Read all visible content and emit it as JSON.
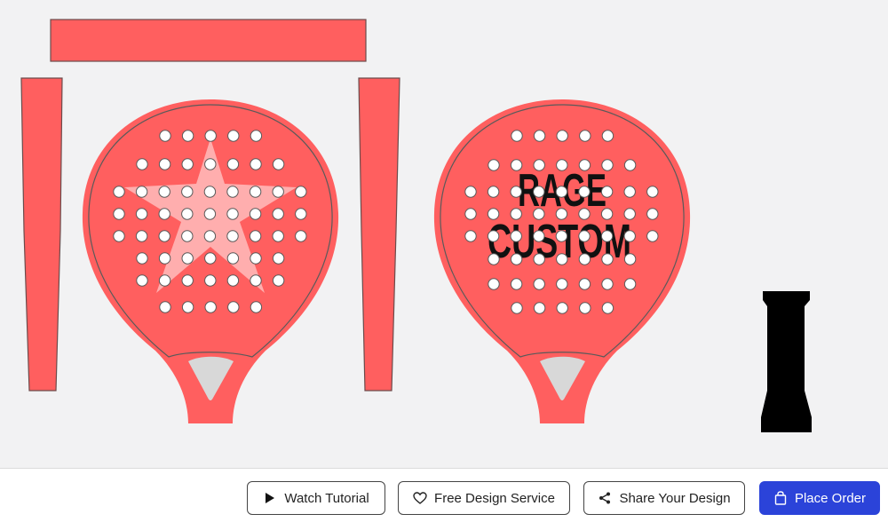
{
  "design": {
    "paddle_color": "#ff5f5f",
    "outline_color": "#5a5a5a",
    "hole_color": "#ffffff",
    "throat_color": "#d8d8d8",
    "star_color": "#ffc8c8",
    "text_color": "#111111",
    "grip_color": "#000000",
    "front_text_line1": "RAGE",
    "front_text_line2": "CUSTOM"
  },
  "footer": {
    "tutorial_label": "Watch Tutorial",
    "tutorial_icon": "play-icon",
    "free_design_label": "Free Design Service",
    "free_design_icon": "heart-icon",
    "share_label": "Share Your Design",
    "share_icon": "share-icon",
    "order_label": "Place Order",
    "order_icon": "bag-icon",
    "primary_color": "#2b43d9"
  }
}
